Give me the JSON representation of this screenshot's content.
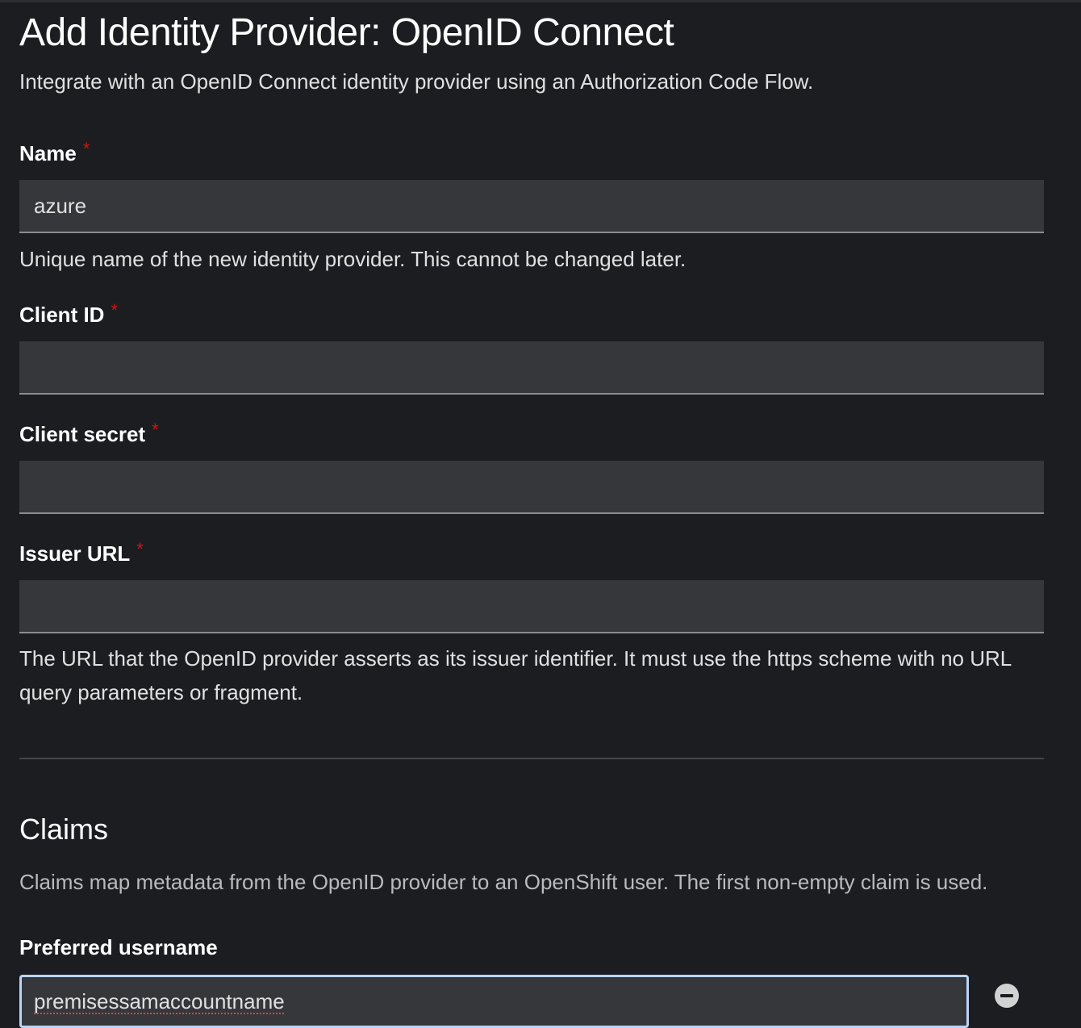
{
  "header": {
    "title": "Add Identity Provider: OpenID Connect",
    "subtitle": "Integrate with an OpenID Connect identity provider using an Authorization Code Flow."
  },
  "form": {
    "name": {
      "label": "Name",
      "required_mark": "*",
      "value": "azure",
      "help": "Unique name of the new identity provider. This cannot be changed later."
    },
    "client_id": {
      "label": "Client ID",
      "required_mark": "*",
      "value": ""
    },
    "client_secret": {
      "label": "Client secret",
      "required_mark": "*",
      "value": ""
    },
    "issuer_url": {
      "label": "Issuer URL",
      "required_mark": "*",
      "value": "",
      "help": "The URL that the OpenID provider asserts as its issuer identifier. It must use the https scheme with no URL query parameters or fragment."
    }
  },
  "claims": {
    "title": "Claims",
    "description": "Claims map metadata from the OpenID provider to an OpenShift user. The first non-empty claim is used.",
    "preferred_username": {
      "label": "Preferred username",
      "value": "premisessamaccountname",
      "remove_icon": "minus-circle-icon"
    }
  },
  "colors": {
    "background": "#1b1d21",
    "input_background": "#36373b",
    "required": "#c9190b",
    "focus_border": "#b9d5f7"
  }
}
